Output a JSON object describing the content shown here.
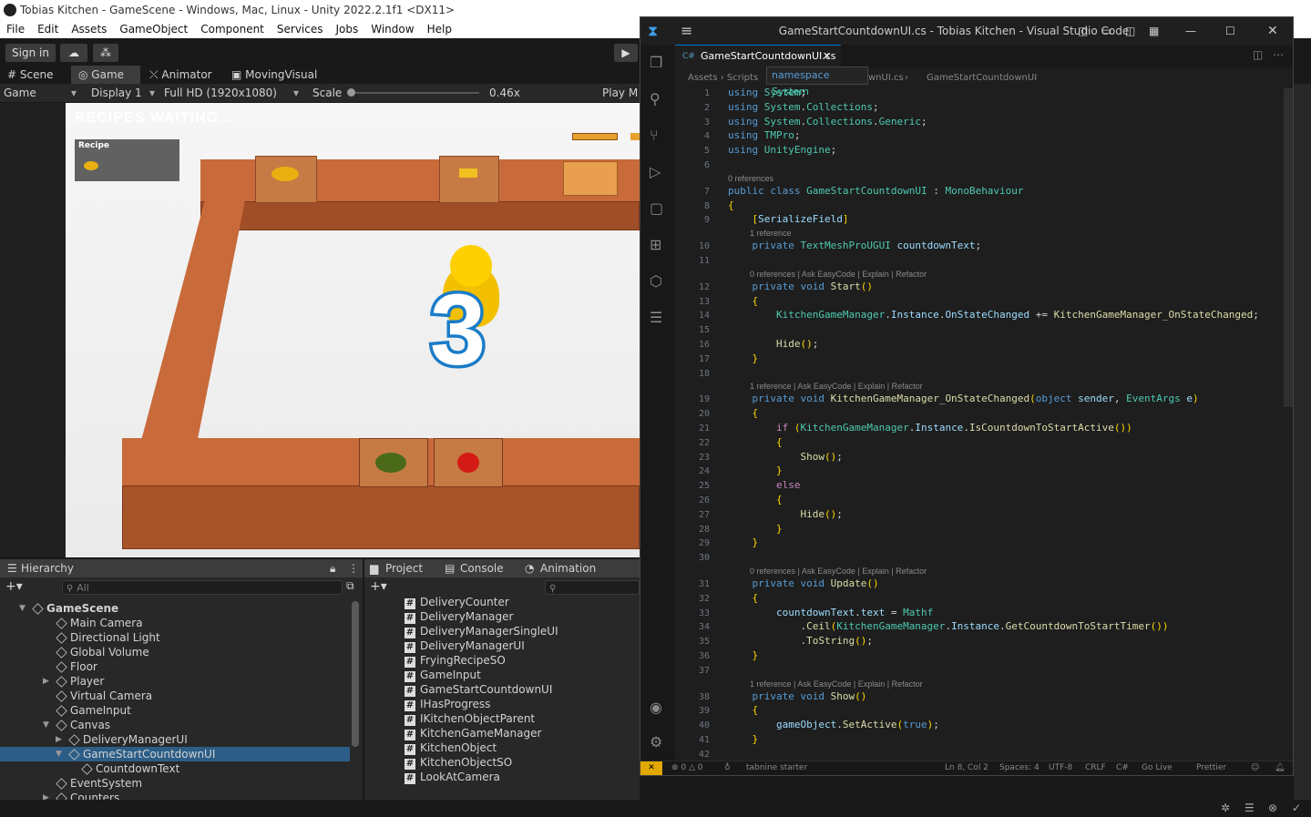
{
  "unity": {
    "window_title": "Tobias Kitchen - GameScene - Windows, Mac, Linux - Unity 2022.2.1f1 <DX11>",
    "menu": [
      "File",
      "Edit",
      "Assets",
      "GameObject",
      "Component",
      "Services",
      "Jobs",
      "Window",
      "Help"
    ],
    "sign_in": "Sign in",
    "tabs": {
      "scene": "Scene",
      "game": "Game",
      "animator": "Animator",
      "moving_visual": "MovingVisual"
    },
    "gamebar": {
      "mode": "Game",
      "display": "Display 1",
      "resolution": "Full HD (1920x1080)",
      "scale_label": "Scale",
      "scale_value": "0.46x",
      "play_mode": "Play M"
    },
    "game": {
      "recipes_waiting": "RECIPES WAITING...",
      "recipe_label": "Recipe",
      "countdown": "3"
    },
    "hierarchy": {
      "title": "Hierarchy",
      "search_placeholder": "All",
      "items": [
        {
          "label": "GameScene",
          "indent": 0,
          "bold": true
        },
        {
          "label": "Main Camera",
          "indent": 2
        },
        {
          "label": "Directional Light",
          "indent": 2
        },
        {
          "label": "Global Volume",
          "indent": 2
        },
        {
          "label": "Floor",
          "indent": 2
        },
        {
          "label": "Player",
          "indent": 2
        },
        {
          "label": "Virtual Camera",
          "indent": 2
        },
        {
          "label": "GameInput",
          "indent": 2
        },
        {
          "label": "Canvas",
          "indent": 2
        },
        {
          "label": "DeliveryManagerUI",
          "indent": 3
        },
        {
          "label": "GameStartCountdownUI",
          "indent": 3,
          "selected": true
        },
        {
          "label": "CountdownText",
          "indent": 4
        },
        {
          "label": "EventSystem",
          "indent": 2
        },
        {
          "label": "Counters",
          "indent": 2
        }
      ]
    },
    "project": {
      "tabs": {
        "project": "Project",
        "console": "Console",
        "animation": "Animation"
      },
      "files": [
        "DeliveryCounter",
        "DeliveryManager",
        "DeliveryManagerSingleUI",
        "DeliveryManagerUI",
        "FryingRecipeSO",
        "GameInput",
        "GameStartCountdownUI",
        "IHasProgress",
        "IKitchenObjectParent",
        "KitchenGameManager",
        "KitchenObject",
        "KitchenObjectSO",
        "LookAtCamera"
      ]
    }
  },
  "vscode": {
    "title": "GameStartCountdownUI.cs - Tobias Kitchen - Visual Studio Code",
    "tab": "GameStartCountdownUI.cs",
    "breadcrumb": [
      "Assets",
      "Scripts",
      "wnUI.cs",
      "GameStartCountdownUI"
    ],
    "tooltip_kw": "namespace",
    "tooltip_name": "System",
    "code": [
      {
        "n": "1",
        "t": "using System;"
      },
      {
        "n": "2",
        "t": "using System.Collections;"
      },
      {
        "n": "3",
        "t": "using System.Collections.Generic;"
      },
      {
        "n": "4",
        "t": "using TMPro;"
      },
      {
        "n": "5",
        "t": "using UnityEngine;"
      },
      {
        "n": "6",
        "t": ""
      },
      {
        "n": "7",
        "t": "public class GameStartCountdownUI : MonoBehaviour"
      },
      {
        "n": "8",
        "t": "{"
      },
      {
        "n": "9",
        "t": "    [SerializeField]"
      },
      {
        "n": "10",
        "t": "    private TextMeshProUGUI countdownText;"
      },
      {
        "n": "11",
        "t": ""
      },
      {
        "n": "12",
        "t": "    private void Start()"
      },
      {
        "n": "13",
        "t": "    {"
      },
      {
        "n": "14",
        "t": "        KitchenGameManager.Instance.OnStateChanged += KitchenGameManager_OnStateChanged;"
      },
      {
        "n": "15",
        "t": ""
      },
      {
        "n": "16",
        "t": "        Hide();"
      },
      {
        "n": "17",
        "t": "    }"
      },
      {
        "n": "18",
        "t": ""
      },
      {
        "n": "19",
        "t": "    private void KitchenGameManager_OnStateChanged(object sender, EventArgs e)"
      },
      {
        "n": "20",
        "t": "    {"
      },
      {
        "n": "21",
        "t": "        if (KitchenGameManager.Instance.IsCountdownToStartActive())"
      },
      {
        "n": "22",
        "t": "        {"
      },
      {
        "n": "23",
        "t": "            Show();"
      },
      {
        "n": "24",
        "t": "        }"
      },
      {
        "n": "25",
        "t": "        else"
      },
      {
        "n": "26",
        "t": "        {"
      },
      {
        "n": "27",
        "t": "            Hide();"
      },
      {
        "n": "28",
        "t": "        }"
      },
      {
        "n": "29",
        "t": "    }"
      },
      {
        "n": "30",
        "t": ""
      },
      {
        "n": "31",
        "t": "    private void Update()"
      },
      {
        "n": "32",
        "t": "    {"
      },
      {
        "n": "33",
        "t": "        countdownText.text = Mathf"
      },
      {
        "n": "34",
        "t": "            .Ceil(KitchenGameManager.Instance.GetCountdownToStartTimer())"
      },
      {
        "n": "35",
        "t": "            .ToString();"
      },
      {
        "n": "36",
        "t": "    }"
      },
      {
        "n": "37",
        "t": ""
      },
      {
        "n": "38",
        "t": "    private void Show()"
      },
      {
        "n": "39",
        "t": "    {"
      },
      {
        "n": "40",
        "t": "        gameObject.SetActive(true);"
      },
      {
        "n": "41",
        "t": "    }"
      },
      {
        "n": "42",
        "t": ""
      }
    ],
    "lenses": {
      "l7": "0 references",
      "l10": "1 reference",
      "l12": "0 references | Ask EasyCode | Explain | Refactor",
      "l19": "1 reference | Ask EasyCode | Explain | Refactor",
      "l31": "0 references | Ask EasyCode | Explain | Refactor",
      "l38": "1 reference | Ask EasyCode | Explain | Refactor"
    },
    "status": {
      "errors": "0",
      "warnings": "0",
      "tabnine": "tabnine starter",
      "position": "Ln 8, Col 2",
      "spaces": "Spaces: 4",
      "encoding": "UTF-8",
      "eol": "CRLF",
      "lang": "C#",
      "golive": "Go Live",
      "prettier": "Prettier"
    }
  }
}
